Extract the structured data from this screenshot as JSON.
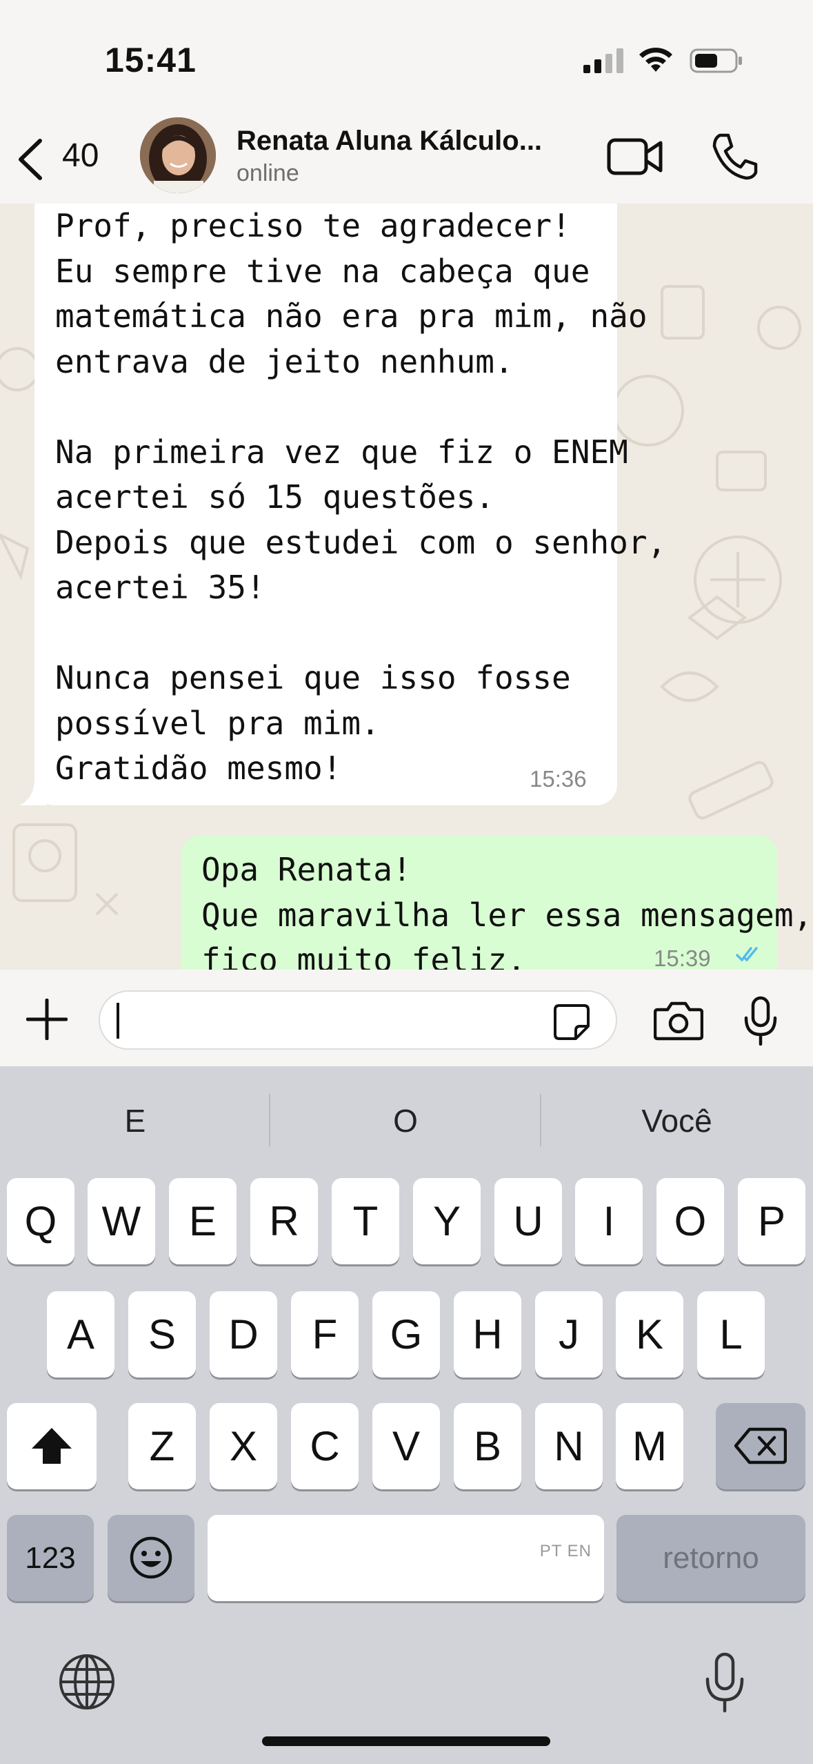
{
  "status_bar": {
    "time": "15:41"
  },
  "header": {
    "back_count": "40",
    "contact_name": "Renata Aluna Kálculo...",
    "contact_status": "online"
  },
  "chat": {
    "incoming": {
      "lines": [
        "Prof, preciso te agradecer!",
        "Eu sempre tive na cabeça que",
        "matemática não era pra mim, não",
        "entrava de jeito nenhum.",
        "",
        "Na primeira vez que fiz o ENEM",
        "acertei só 15 questões.",
        "Depois que estudei com o senhor,",
        "acertei 35!",
        "",
        "Nunca pensei que isso fosse",
        "possível pra mim.",
        "Gratidão mesmo!"
      ],
      "time": "15:36"
    },
    "outgoing": {
      "lines": [
        "Opa Renata!",
        "Que maravilha ler essa mensagem,",
        "fico muito feliz."
      ],
      "time": "15:39"
    }
  },
  "input": {
    "placeholder": ""
  },
  "keyboard": {
    "suggestions": [
      "E",
      "O",
      "Você"
    ],
    "row1": [
      "Q",
      "W",
      "E",
      "R",
      "T",
      "Y",
      "U",
      "I",
      "O",
      "P"
    ],
    "row2": [
      "A",
      "S",
      "D",
      "F",
      "G",
      "H",
      "J",
      "K",
      "L"
    ],
    "row3": [
      "Z",
      "X",
      "C",
      "V",
      "B",
      "N",
      "M"
    ],
    "numbers_key": "123",
    "return_key": "retorno",
    "space_hint": "PT EN"
  },
  "colors": {
    "incoming_bubble": "#ffffff",
    "outgoing_bubble": "#d9fdd3",
    "read_ticks": "#53bdeb",
    "keyboard_bg": "#d1d3d9"
  }
}
